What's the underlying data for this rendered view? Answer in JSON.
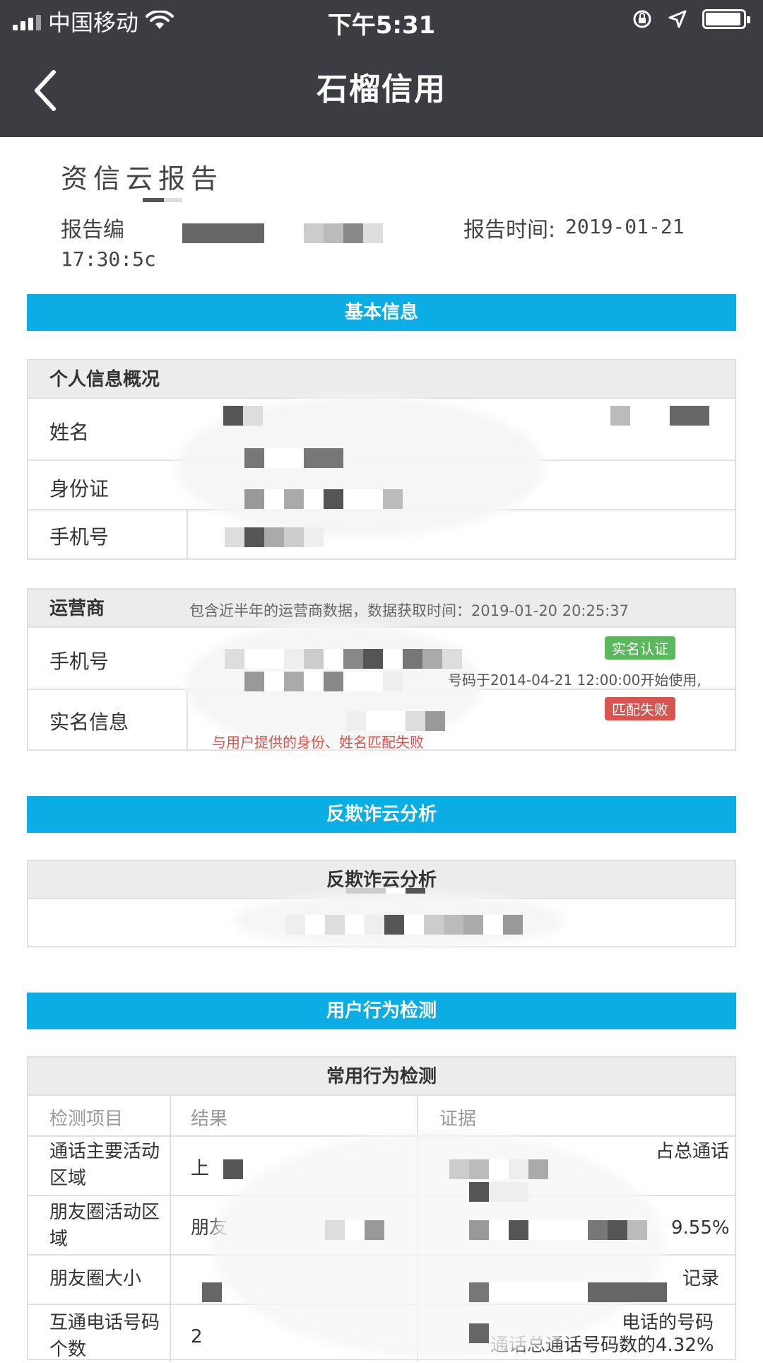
{
  "status_bar": {
    "carrier": "中国移动",
    "time": "下午5:31",
    "battery_level": 0.95
  },
  "nav": {
    "title": "石榴信用"
  },
  "report": {
    "title": "资信云报告",
    "number_label": "报告编",
    "time_label": "报告时间:",
    "time_value": "2019-01-21",
    "time_value_2": "17:30:5c"
  },
  "sections": {
    "basic": "基本信息",
    "anti_fraud": "反欺诈云分析",
    "behavior": "用户行为检测"
  },
  "personal": {
    "header": "个人信息概况",
    "rows": [
      "姓名",
      "身份证",
      "手机号"
    ]
  },
  "carrier": {
    "header": "运营商",
    "note": "包含近半年的运营商数据，数据获取时间：2019-01-20 20:25:37",
    "rows": [
      "手机号",
      "实名信息"
    ],
    "tag_verified": "实名认证",
    "tag_mismatch": "匹配失败",
    "start_note": "号码于2014-04-21 12:00:00开始使用,",
    "mismatch_note": "与用户提供的身份、姓名匹配失败"
  },
  "anti_fraud_table": {
    "header": "反欺诈云分析"
  },
  "behavior_table": {
    "header": "常用行为检测",
    "columns": [
      "检测项目",
      "结果",
      "证据"
    ],
    "rows": [
      {
        "item": "通话主要活动区域",
        "result": "上",
        "evidence": "占总通话"
      },
      {
        "item": "朋友圈活动区域",
        "result": "朋友",
        "evidence": "9.55%"
      },
      {
        "item": "朋友圈大小",
        "result": "",
        "evidence": "记录"
      },
      {
        "item": "互通电话号码个数",
        "result": "2",
        "evidence": "电话的号码",
        "evidence2": "通话总通话号码数的4.32%"
      }
    ]
  },
  "colors": {
    "nav_bg": "#3b3d43",
    "section_bar": "#0aaee5",
    "tag_green": "#5cb85c",
    "tag_red": "#d9534f"
  }
}
